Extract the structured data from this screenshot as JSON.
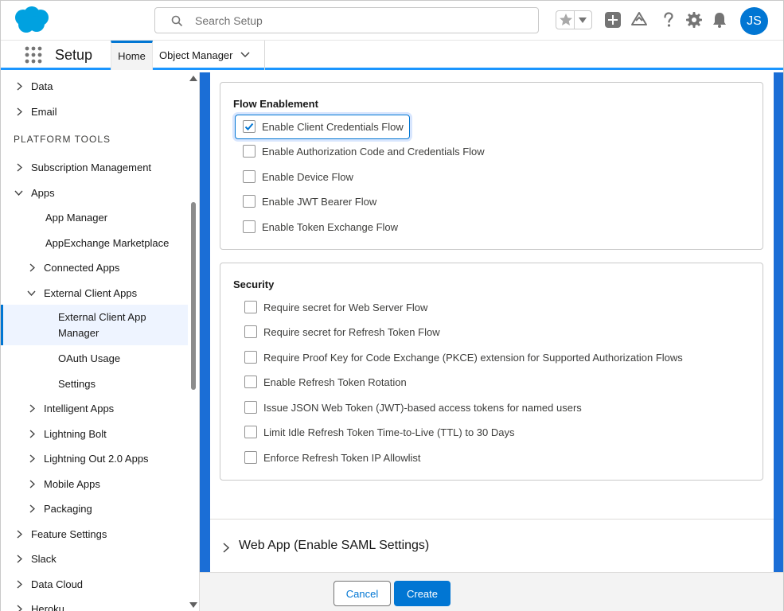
{
  "colors": {
    "brand": "#0176d3",
    "accent": "#1b96ff",
    "logo": "#00a1e0"
  },
  "header": {
    "search_placeholder": "Search Setup",
    "avatar_initials": "JS",
    "icons": [
      "salesforce-logo-icon",
      "search-icon",
      "star-icon",
      "caret-down-icon",
      "add-icon",
      "trailhead-icon",
      "help-icon",
      "gear-icon",
      "bell-icon"
    ]
  },
  "context_bar": {
    "app_name": "Setup",
    "tabs": [
      {
        "label": "Home"
      },
      {
        "label": "Object Manager"
      }
    ]
  },
  "sidebar": {
    "items": [
      {
        "label": "Data"
      },
      {
        "label": "Email"
      },
      {
        "label": "PLATFORM TOOLS"
      },
      {
        "label": "Subscription Management"
      },
      {
        "label": "Apps"
      },
      {
        "label": "App Manager"
      },
      {
        "label": "AppExchange Marketplace"
      },
      {
        "label": "Connected Apps"
      },
      {
        "label": "External Client Apps"
      },
      {
        "label": "External Client App Manager"
      },
      {
        "label": "OAuth Usage"
      },
      {
        "label": "Settings"
      },
      {
        "label": "Intelligent Apps"
      },
      {
        "label": "Lightning Bolt"
      },
      {
        "label": "Lightning Out 2.0 Apps"
      },
      {
        "label": "Mobile Apps"
      },
      {
        "label": "Packaging"
      },
      {
        "label": "Feature Settings"
      },
      {
        "label": "Slack"
      },
      {
        "label": "Data Cloud"
      },
      {
        "label": "Heroku"
      }
    ]
  },
  "flow_enablement": {
    "title": "Flow Enablement",
    "options": [
      {
        "label": "Enable Client Credentials Flow",
        "checked": true
      },
      {
        "label": "Enable Authorization Code and Credentials Flow",
        "checked": false
      },
      {
        "label": "Enable Device Flow",
        "checked": false
      },
      {
        "label": "Enable JWT Bearer Flow",
        "checked": false
      },
      {
        "label": "Enable Token Exchange Flow",
        "checked": false
      }
    ]
  },
  "security": {
    "title": "Security",
    "options": [
      {
        "label": "Require secret for Web Server Flow",
        "checked": false
      },
      {
        "label": "Require secret for Refresh Token Flow",
        "checked": false
      },
      {
        "label": "Require Proof Key for Code Exchange (PKCE) extension for Supported Authorization Flows",
        "checked": false
      },
      {
        "label": "Enable Refresh Token Rotation",
        "checked": false
      },
      {
        "label": "Issue JSON Web Token (JWT)-based access tokens for named users",
        "checked": false
      },
      {
        "label": "Limit Idle Refresh Token Time-to-Live (TTL) to 30 Days",
        "checked": false
      },
      {
        "label": "Enforce Refresh Token IP Allowlist",
        "checked": false
      }
    ]
  },
  "web_app_section": {
    "label": "Web App (Enable SAML Settings)"
  },
  "footer": {
    "cancel_label": "Cancel",
    "create_label": "Create"
  }
}
